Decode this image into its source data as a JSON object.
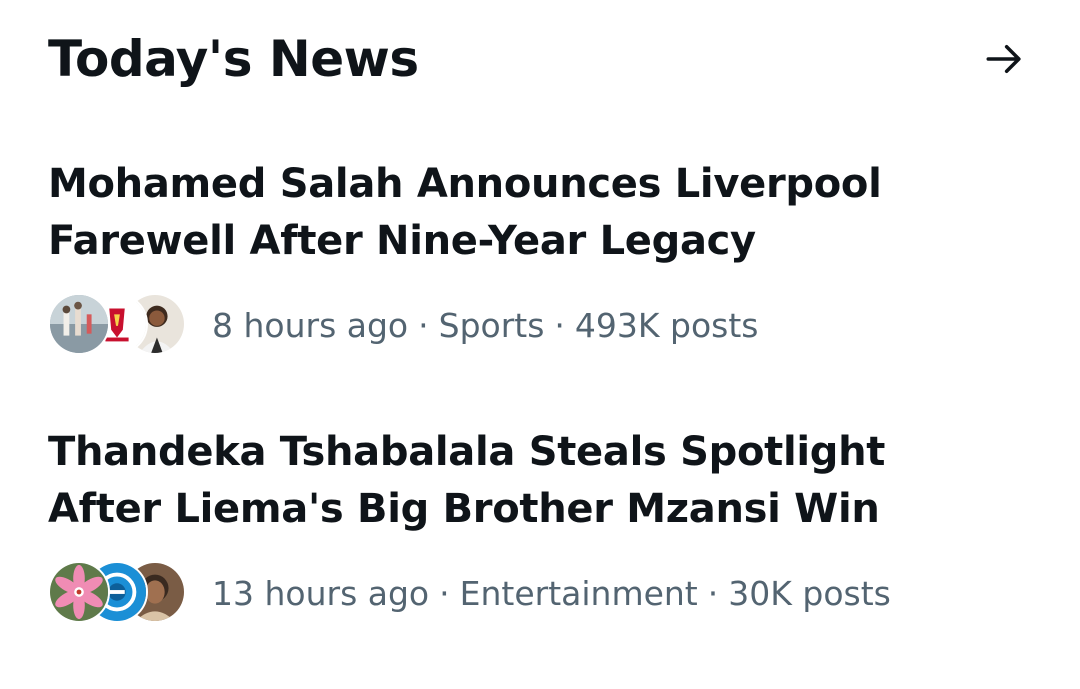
{
  "header": {
    "title": "Today's News",
    "arrow_icon": "arrow-right-icon"
  },
  "news": [
    {
      "headline": "Mohamed Salah Announces Liverpool\nFarewell After Nine-Year Legacy",
      "time": "8 hours ago",
      "category": "Sports",
      "posts": "493K posts",
      "separator": "·",
      "avatars": [
        "beach-photo-avatar",
        "liverpool-fc-crest-avatar",
        "person-portrait-avatar"
      ]
    },
    {
      "headline": "Thandeka Tshabalala Steals Spotlight\nAfter Liema's Big Brother Mzansi Win",
      "time": "13 hours ago",
      "category": "Entertainment",
      "posts": "30K posts",
      "separator": "·",
      "avatars": [
        "pink-lily-flower-avatar",
        "blue-logo-avatar",
        "person-photo-avatar"
      ]
    }
  ],
  "colors": {
    "text_primary": "#0f1419",
    "text_secondary": "#536471",
    "background": "#ffffff"
  }
}
